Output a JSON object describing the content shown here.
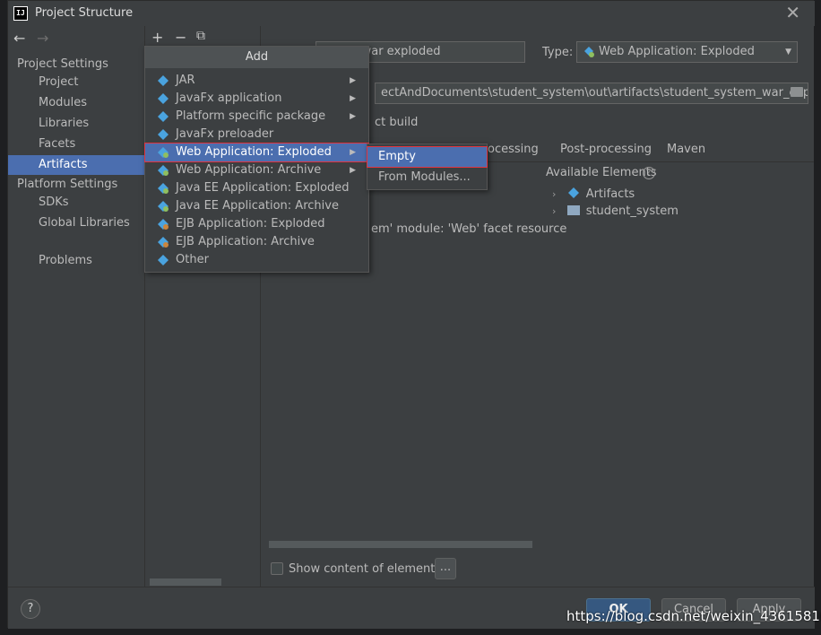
{
  "window": {
    "title": "Project Structure",
    "close_glyph": "✕"
  },
  "nav": {
    "back": "←",
    "forward": "→"
  },
  "sidebar": {
    "project_settings": "Project Settings",
    "items": [
      "Project",
      "Modules",
      "Libraries",
      "Facets",
      "Artifacts"
    ],
    "platform_settings": "Platform Settings",
    "platform_items": [
      "SDKs",
      "Global Libraries"
    ],
    "problems": "Problems"
  },
  "toolbar": {
    "add": "+",
    "remove": "−",
    "copy": "⧉"
  },
  "artifact": {
    "name_value": "ystem:war exploded",
    "type_label": "Type:",
    "type_value": "Web Application: Exploded",
    "output_path": "ectAndDocuments\\student_system\\out\\artifacts\\student_system_war_exploded",
    "build_text": "ct build",
    "tab_preprocessing": "ocessing",
    "tab_postprocessing": "Post-processing",
    "tab_maven": "Maven",
    "available_elements": "Available Elements",
    "tree": [
      "Artifacts",
      "student_system"
    ],
    "content_text": "em' module: 'Web' facet resource",
    "show_content": "Show content of elements",
    "ellipsis": "..."
  },
  "add_menu": {
    "title": "Add",
    "items": [
      {
        "label": "JAR",
        "arrow": true
      },
      {
        "label": "JavaFx application",
        "arrow": true
      },
      {
        "label": "Platform specific package",
        "arrow": true
      },
      {
        "label": "JavaFx preloader",
        "arrow": false
      },
      {
        "label": "Web Application: Exploded",
        "arrow": true
      },
      {
        "label": "Web Application: Archive",
        "arrow": true
      },
      {
        "label": "Java EE Application: Exploded",
        "arrow": false
      },
      {
        "label": "Java EE Application: Archive",
        "arrow": false
      },
      {
        "label": "EJB Application: Exploded",
        "arrow": false
      },
      {
        "label": "EJB Application: Archive",
        "arrow": false
      },
      {
        "label": "Other",
        "arrow": false
      }
    ]
  },
  "sub_menu": {
    "items": [
      "Empty",
      "From Modules..."
    ]
  },
  "buttons": {
    "help": "?",
    "ok": "OK",
    "cancel": "Cancel",
    "apply": "Apply"
  },
  "watermark": "https://blog.csdn.net/weixin_43615816",
  "colors": {
    "selection": "#4b6eaf",
    "highlight_border": "#e0343f",
    "background": "#3c3f41"
  }
}
